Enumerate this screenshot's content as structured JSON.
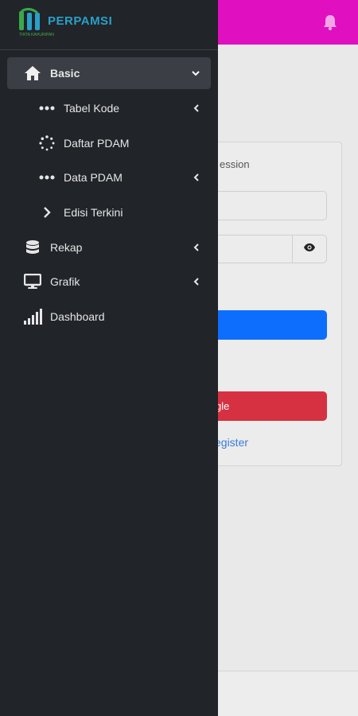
{
  "colors": {
    "topbar": "#e00fbf",
    "sidebar": "#212429",
    "active_item": "#3b3f45",
    "primary_button": "#0d6efd",
    "google_button": "#d63140",
    "link": "#3a7bd5"
  },
  "topbar": {
    "icon": "bell-icon"
  },
  "brand": {
    "name": "PERPAMSI",
    "sub": "TIRTA KAHURIPAN"
  },
  "card": {
    "message": "ession",
    "google_label": "gle",
    "register_label": "egister"
  },
  "sidebar": {
    "items": [
      {
        "label": "Basic",
        "icon": "home-icon",
        "level": 0,
        "active": true,
        "chevron": "down"
      },
      {
        "label": "Tabel Kode",
        "icon": "dots-icon",
        "level": 1,
        "chevron": "left"
      },
      {
        "label": "Daftar PDAM",
        "icon": "spinner-icon",
        "level": 1,
        "chevron": ""
      },
      {
        "label": "Data PDAM",
        "icon": "dots-icon",
        "level": 1,
        "chevron": "left"
      },
      {
        "label": "Edisi Terkini",
        "icon": "chevron-right-icon",
        "level": 1,
        "chevron": ""
      },
      {
        "label": "Rekap",
        "icon": "database-icon",
        "level": 0,
        "chevron": "left"
      },
      {
        "label": "Grafik",
        "icon": "monitor-icon",
        "level": 0,
        "chevron": "left"
      },
      {
        "label": "Dashboard",
        "icon": "signal-bars-icon",
        "level": 0,
        "chevron": ""
      }
    ]
  }
}
